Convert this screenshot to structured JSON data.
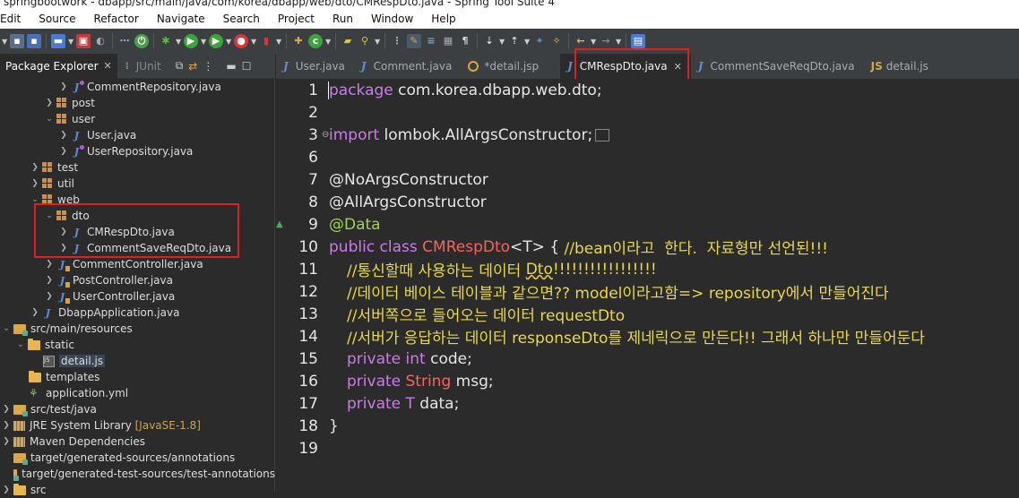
{
  "window": {
    "title": "springbootwork - dbapp/src/main/java/com/korea/dbapp/web/dto/CMRespDto.java - Spring Tool Suite 4"
  },
  "menu": [
    "Edit",
    "Source",
    "Refactor",
    "Navigate",
    "Search",
    "Project",
    "Run",
    "Window",
    "Help"
  ],
  "left_panel": {
    "tab_active": "Package Explorer",
    "tab_inactive": "JUnit",
    "tree": [
      {
        "label": "CommentRepository.java"
      },
      {
        "label": "post"
      },
      {
        "label": "user"
      },
      {
        "label": "User.java"
      },
      {
        "label": "UserRepository.java"
      },
      {
        "label": "test"
      },
      {
        "label": "util"
      },
      {
        "label": "web"
      },
      {
        "label": "dto"
      },
      {
        "label": "CMRespDto.java"
      },
      {
        "label": "CommentSaveReqDto.java"
      },
      {
        "label": "CommentController.java"
      },
      {
        "label": "PostController.java"
      },
      {
        "label": "UserController.java"
      },
      {
        "label": "DbappApplication.java"
      },
      {
        "label": "src/main/resources"
      },
      {
        "label": "static"
      },
      {
        "label": "detail.js"
      },
      {
        "label": "templates"
      },
      {
        "label": "application.yml"
      },
      {
        "label": "src/test/java"
      },
      {
        "label": "JRE System Library",
        "suffix": "[JavaSE-1.8]"
      },
      {
        "label": "Maven Dependencies"
      },
      {
        "label": "target/generated-sources/annotations"
      },
      {
        "label": "target/generated-test-sources/test-annotations"
      },
      {
        "label": "src"
      }
    ]
  },
  "editor": {
    "tabs": [
      {
        "label": "User.java"
      },
      {
        "label": "Comment.java"
      },
      {
        "label": "*detail.jsp"
      },
      {
        "label": "CMRespDto.java"
      },
      {
        "label": "CommentSaveReqDto.java"
      },
      {
        "label": "detail.js"
      }
    ],
    "lines": {
      "n": [
        "1",
        "2",
        "3",
        "6",
        "7",
        "8",
        "9",
        "10",
        "11",
        "12",
        "13",
        "14",
        "15",
        "16",
        "17",
        "18",
        "19"
      ],
      "l1_kw": "package",
      "l1_rest": " com.korea.dbapp.web.dto;",
      "l3_kw": "import",
      "l3_rest": " lombok.AllArgsConstructor;",
      "l7": "@NoArgsConstructor",
      "l8": "@AllArgsConstructor",
      "l9": "@Data",
      "l10_kw": "public class",
      "l10_cls": "CMRespDto",
      "l10_gen": "<T> { ",
      "l10_cmt": "//bean이라고  한다.  자료형만 선언된!!!",
      "l11_pre": "//통신할때 사용하는 데이터 ",
      "l11_sq": "Dto",
      "l11_post": "!!!!!!!!!!!!!!!!!",
      "l12": "//데이터 베이스 테이블과 같으면?? model이라고함=> repository에서 만들어진다",
      "l13": "//서버쪽으로 들어오는 데이터 requestDto",
      "l14": "//서버가 응답하는 데이터 responseDto를 제네릭으로 만든다!! 그래서 하나만 만들어둔다",
      "l15_kw": "private int",
      "l15_rest": " code;",
      "l16_kw": "private",
      "l16_cls": "String",
      "l16_rest": " msg;",
      "l17_kw": "private",
      "l17_t": "T",
      "l17_rest": " data;",
      "l18": "}"
    }
  }
}
